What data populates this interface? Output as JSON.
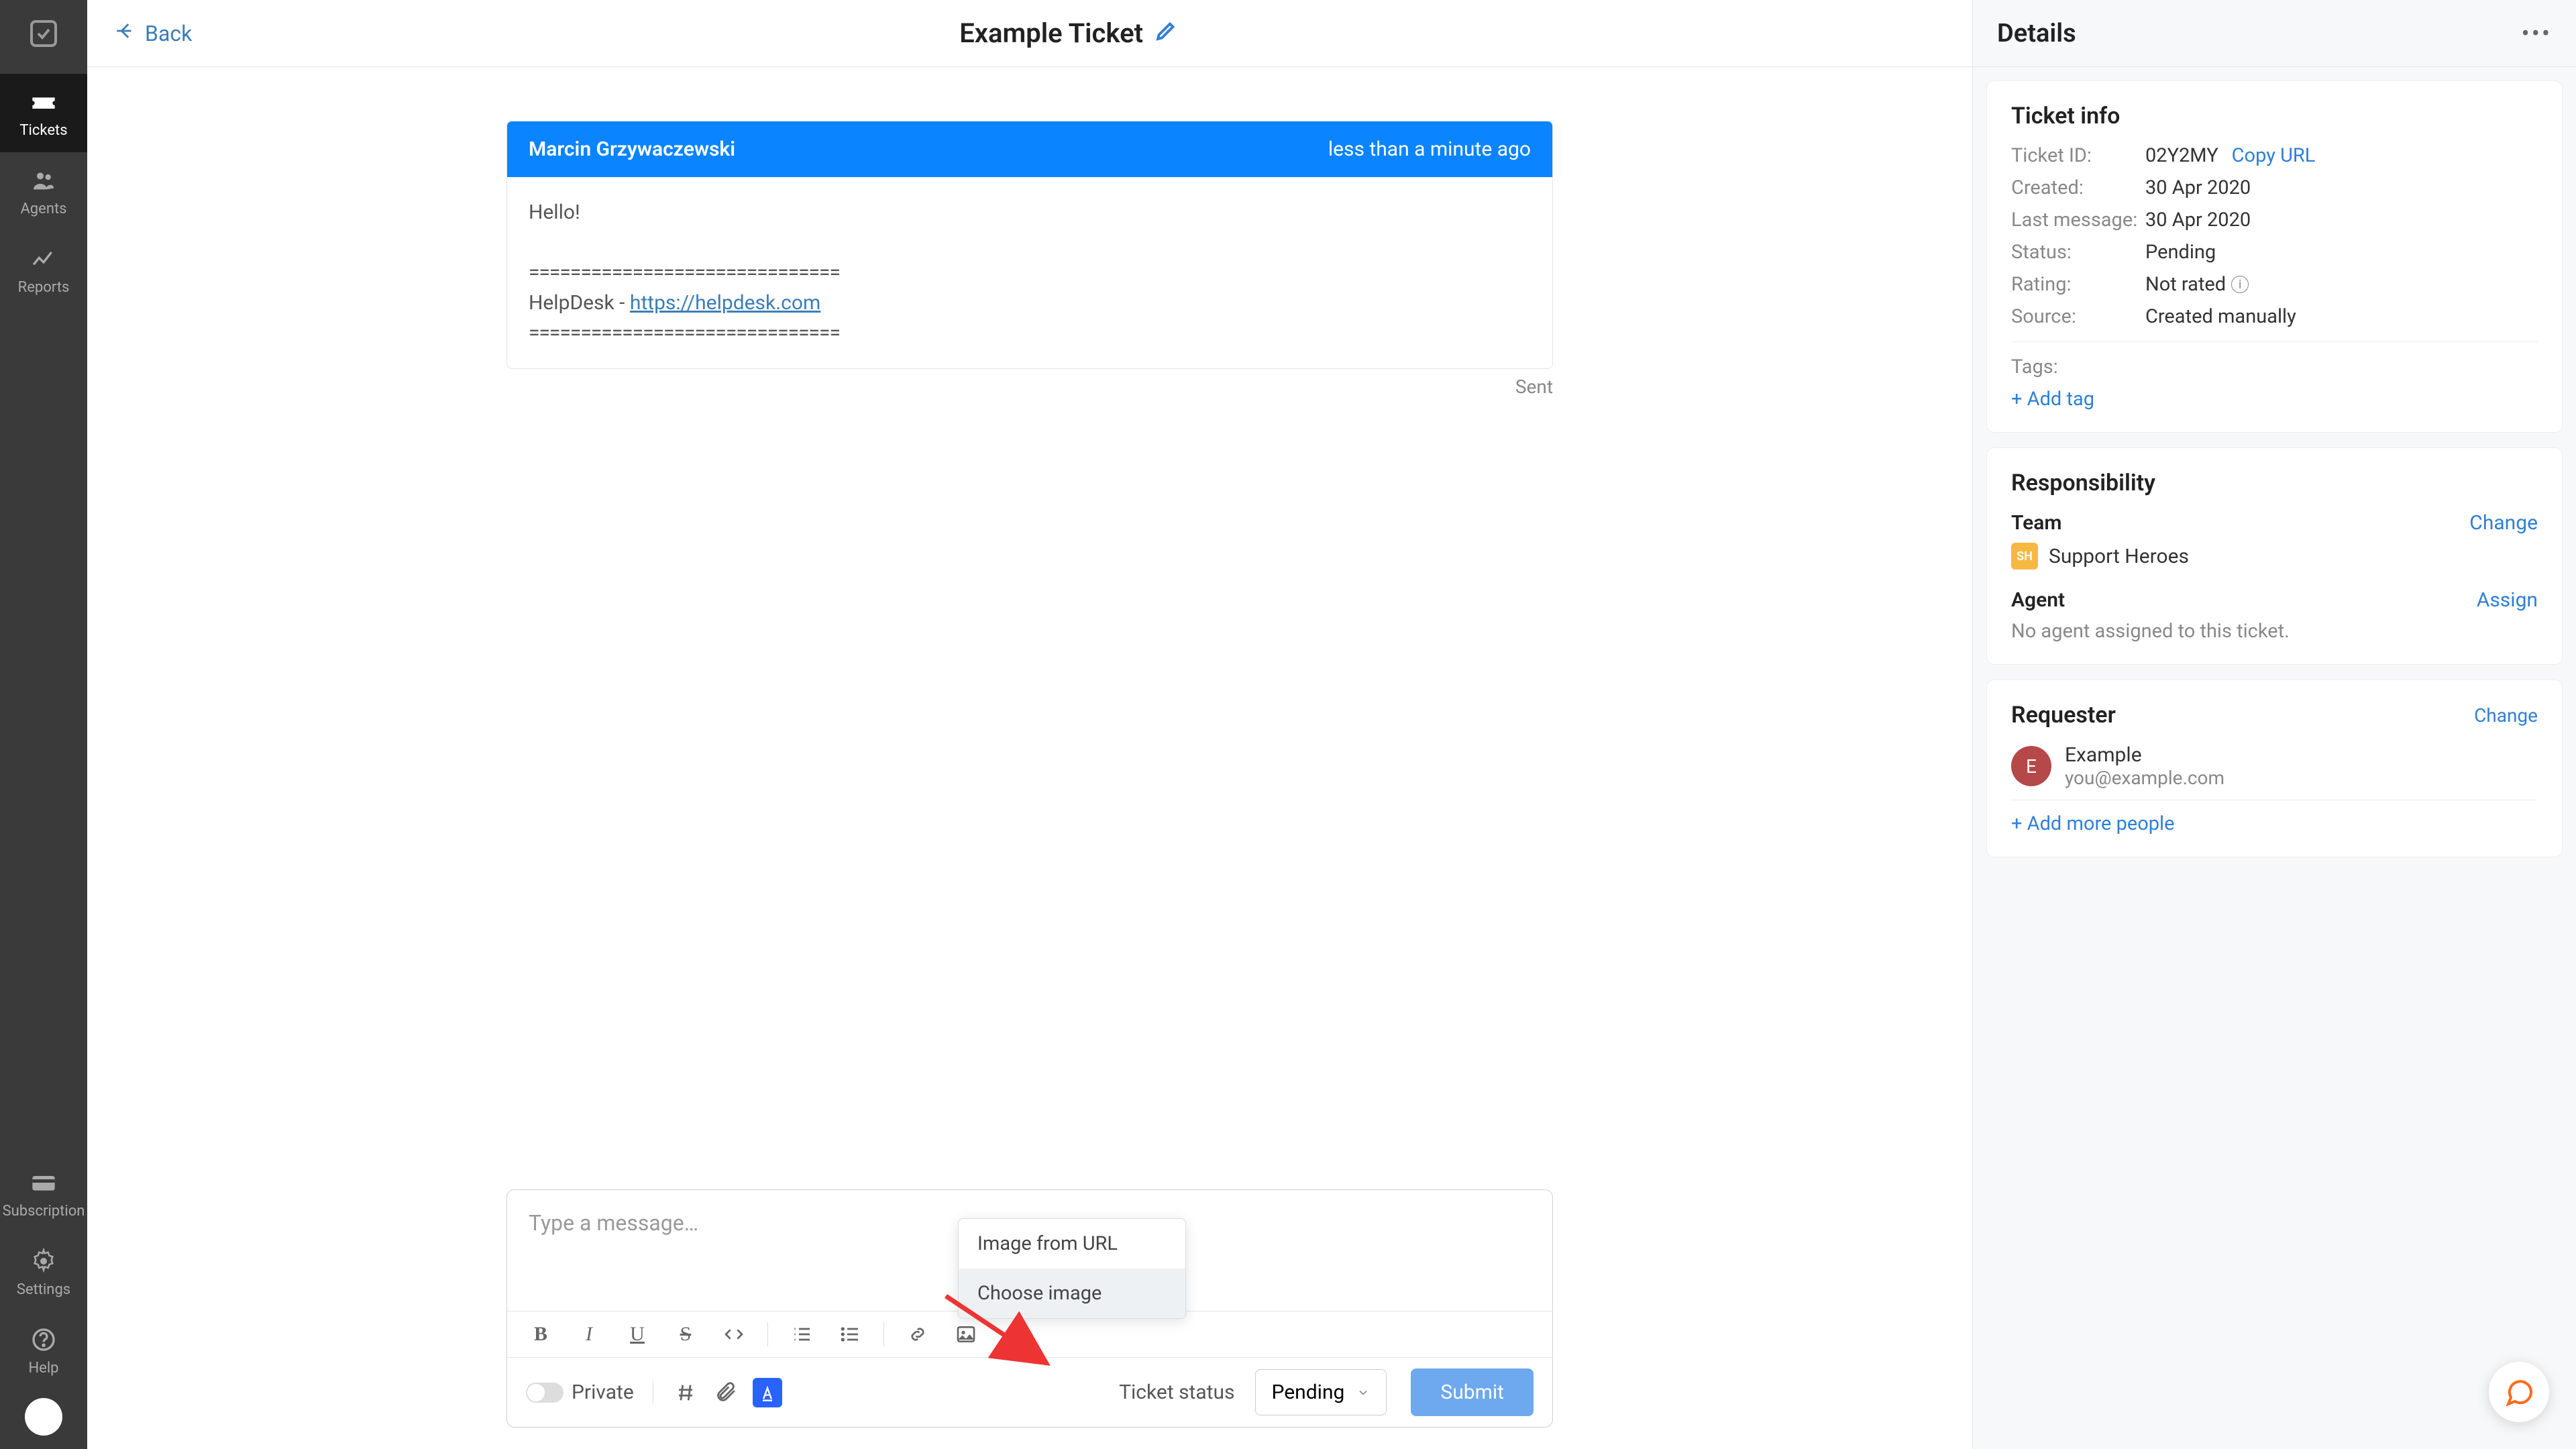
{
  "sidebar": {
    "items": [
      {
        "label": "Tickets"
      },
      {
        "label": "Agents"
      },
      {
        "label": "Reports"
      }
    ],
    "bottom": [
      {
        "label": "Subscription"
      },
      {
        "label": "Settings"
      },
      {
        "label": "Help"
      }
    ]
  },
  "header": {
    "back": "Back",
    "title": "Example Ticket"
  },
  "message": {
    "sender": "Marcin Grzywaczewski",
    "time": "less than a minute ago",
    "body_line1": "Hello!",
    "sep": "==============================",
    "signature_prefix": "HelpDesk - ",
    "signature_link": "https://helpdesk.com",
    "sep2": "==============================",
    "sent": "Sent"
  },
  "composer": {
    "placeholder": "Type a message…",
    "private": "Private",
    "status_label": "Ticket status",
    "status_value": "Pending",
    "submit": "Submit"
  },
  "image_popup": {
    "from_url": "Image from URL",
    "choose": "Choose image"
  },
  "panel": {
    "title": "Details",
    "ticket_info": {
      "title": "Ticket info",
      "id_label": "Ticket ID:",
      "id_value": "02Y2MY",
      "copy": "Copy URL",
      "created_label": "Created:",
      "created_value": "30 Apr 2020",
      "last_label": "Last message:",
      "last_value": "30 Apr 2020",
      "status_label": "Status:",
      "status_value": "Pending",
      "rating_label": "Rating:",
      "rating_value": "Not rated",
      "source_label": "Source:",
      "source_value": "Created manually",
      "tags_label": "Tags:",
      "add_tag": "+ Add tag"
    },
    "responsibility": {
      "title": "Responsibility",
      "team_label": "Team",
      "team_change": "Change",
      "team_badge": "SH",
      "team_name": "Support Heroes",
      "agent_label": "Agent",
      "agent_assign": "Assign",
      "no_agent": "No agent assigned to this ticket."
    },
    "requester": {
      "title": "Requester",
      "change": "Change",
      "initial": "E",
      "name": "Example",
      "email": "you@example.com",
      "add_more": "+ Add more people"
    }
  }
}
